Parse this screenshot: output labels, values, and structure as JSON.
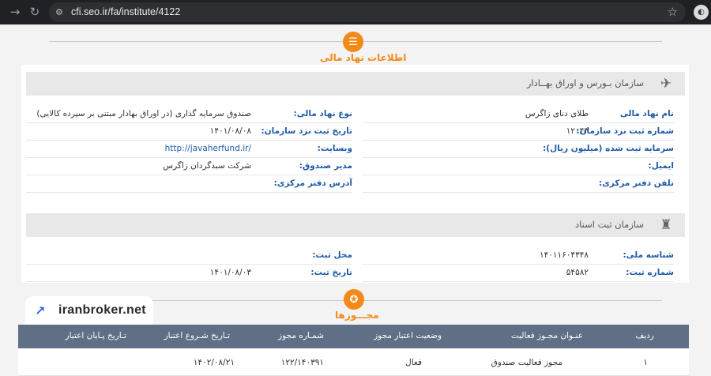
{
  "browser": {
    "url": "cfi.seo.ir/fa/institute/4122"
  },
  "sections": {
    "institution_info_title": "اطلاعات نهاد مالی",
    "licenses_title": "مجـــوزها"
  },
  "securities_org": {
    "name": "سازمان بـورس و اوراق بهــادار",
    "right_fields": [
      {
        "label": "نام نهاد مالی",
        "value": "طلای دنای زاگرس"
      },
      {
        "label": "شماره ثبت نزد سازمان:",
        "value": "۱۲۰۴۳"
      },
      {
        "label": "سرمایه ثبت شده (میلیون ریال):",
        "value": ""
      },
      {
        "label": "ایمیل:",
        "value": ""
      },
      {
        "label": "تلفن دفتر مرکزی:",
        "value": ""
      }
    ],
    "left_fields": [
      {
        "label": "نوع نهاد مالی:",
        "value": "صندوق سرمایه گذاری (در اوراق بهادار مبتنی بر سپرده کالایی)"
      },
      {
        "label": "تاریخ ثبت نزد سازمان:",
        "value": "۱۴۰۱/۰۸/۰۸"
      },
      {
        "label": "وبسایت:",
        "value": "http://javaherfund.ir/"
      },
      {
        "label": "مدیر صندوق:",
        "value": "شرکت سبدگردان زاگرس"
      },
      {
        "label": "آدرس دفتر مرکزی:",
        "value": ""
      }
    ]
  },
  "registry_org": {
    "name": "سازمان ثبت اسناد",
    "right_fields": [
      {
        "label": "شناسه ملی:",
        "value": "۱۴۰۱۱۶۰۴۳۴۸"
      },
      {
        "label": "شماره ثبت:",
        "value": "۵۴۵۸۲"
      }
    ],
    "left_fields": [
      {
        "label": "محل ثبت:",
        "value": ""
      },
      {
        "label": "تاریخ ثبت:",
        "value": "۱۴۰۱/۰۸/۰۳"
      }
    ]
  },
  "licenses_table": {
    "headers": {
      "row": "ردیف",
      "title": "عنـوان مجـوز فعالیت",
      "status": "وضعیت اعتبار مجوز",
      "number": "شمـاره مجوز",
      "start": "تـاریخ شـروع اعتبار",
      "end": "تـاریخ پـایان اعتبار"
    },
    "rows": [
      {
        "row": "۱",
        "title": "مجوز فعالیت صندوق",
        "status": "فعال",
        "number": "۱۲۲/۱۴۰۳۹۱",
        "start": "۱۴۰۲/۰۸/۲۱",
        "end": ""
      }
    ]
  },
  "watermark": {
    "text": "iranbroker.net"
  }
}
